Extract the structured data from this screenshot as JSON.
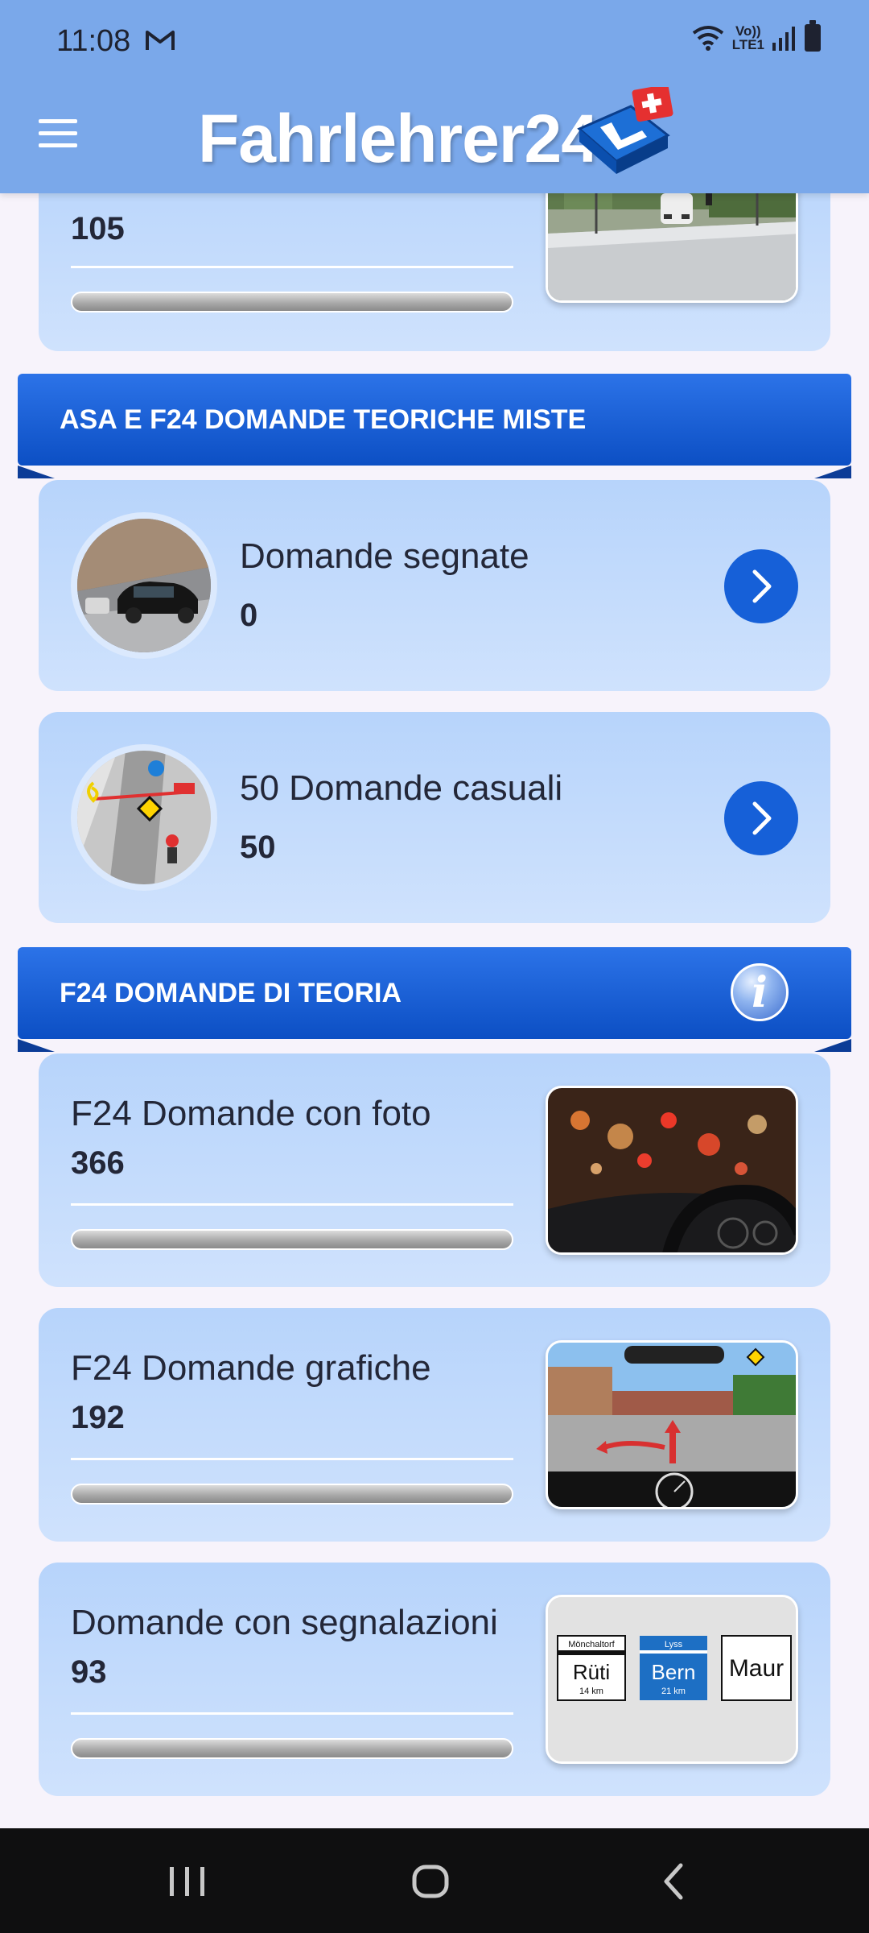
{
  "status_bar": {
    "time": "11:08",
    "volte_line1": "Vo))",
    "volte_line2": "LTE1"
  },
  "app_bar": {
    "title": "Fahrlehrer24"
  },
  "top_card": {
    "count": "105",
    "progress": 0
  },
  "sections": [
    {
      "title": "ASA E F24 DOMANDE TEORICHE MISTE",
      "items": [
        {
          "title": "Domande segnate",
          "count": "0"
        },
        {
          "title": "50 Domande casuali",
          "count": "50"
        }
      ]
    },
    {
      "title": "F24 DOMANDE DI TEORIA",
      "items": [
        {
          "title": "F24 Domande con foto",
          "count": "366",
          "progress": 0
        },
        {
          "title": "F24 Domande grafiche",
          "count": "192",
          "progress": 0
        },
        {
          "title": "Domande con segnalazioni",
          "count": "93",
          "progress": 0
        }
      ]
    }
  ],
  "signs": {
    "sign1_top": "Mönchaltorf",
    "sign1_main": "Rüti",
    "sign1_dist": "14 km",
    "sign2_top": "Lyss",
    "sign2_main": "Bern",
    "sign2_dist": "21 km",
    "sign3_main": "Maur"
  },
  "colors": {
    "app_bar": "#7aa8ea",
    "section_banner": "#0c4fc4",
    "card": "#c4dbfc",
    "accent": "#1660d8"
  }
}
